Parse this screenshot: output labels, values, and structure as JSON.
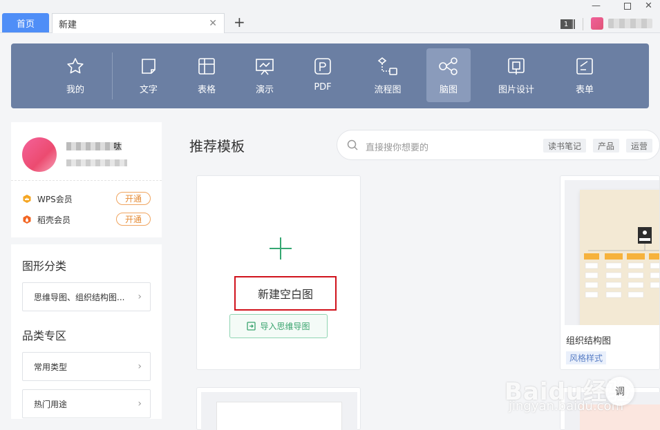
{
  "tabs": {
    "home_label": "首页",
    "new_label": "新建"
  },
  "titlebar": {
    "window_badge": "1"
  },
  "toolbar": {
    "items": [
      {
        "label": "我的",
        "icon": "star-icon"
      },
      {
        "label": "文字",
        "icon": "document-icon"
      },
      {
        "label": "表格",
        "icon": "spreadsheet-icon"
      },
      {
        "label": "演示",
        "icon": "presentation-icon"
      },
      {
        "label": "PDF",
        "icon": "pdf-icon"
      },
      {
        "label": "流程图",
        "icon": "flowchart-icon"
      },
      {
        "label": "脑图",
        "icon": "mindmap-icon",
        "active": true
      },
      {
        "label": "图片设计",
        "icon": "image-design-icon"
      },
      {
        "label": "表单",
        "icon": "form-icon"
      }
    ],
    "background_color": "#6b7fa3",
    "active_color": "#8a9bbb"
  },
  "user": {
    "name_suffix": "呔",
    "memberships": [
      {
        "label": "WPS会员",
        "action": "开通",
        "icon": "wps-crown-icon"
      },
      {
        "label": "稻壳会员",
        "action": "开通",
        "icon": "docer-flame-icon"
      }
    ]
  },
  "categories": {
    "shape_title": "图形分类",
    "shape_item": "思维导图、组织结构图...",
    "zone_title": "品类专区",
    "zone_items": [
      "常用类型",
      "热门用途"
    ]
  },
  "main": {
    "section_title": "推荐模板",
    "search_placeholder": "直接搜你想要的",
    "search_tags": [
      "读书笔记",
      "产品",
      "运营"
    ],
    "blank_card": {
      "title": "新建空白图",
      "import_label": "导入思维导图"
    },
    "template_card": {
      "name": "组织结构图",
      "tag": "风格样式"
    }
  },
  "floating": {
    "label": "调"
  },
  "watermark": {
    "text": "Baidu经验",
    "sub": "jingyan.baidu.com"
  },
  "colors": {
    "accent_blue": "#4f8ef7",
    "highlight_red": "#d0111b",
    "green": "#39a46e",
    "orange": "#e48a34"
  }
}
